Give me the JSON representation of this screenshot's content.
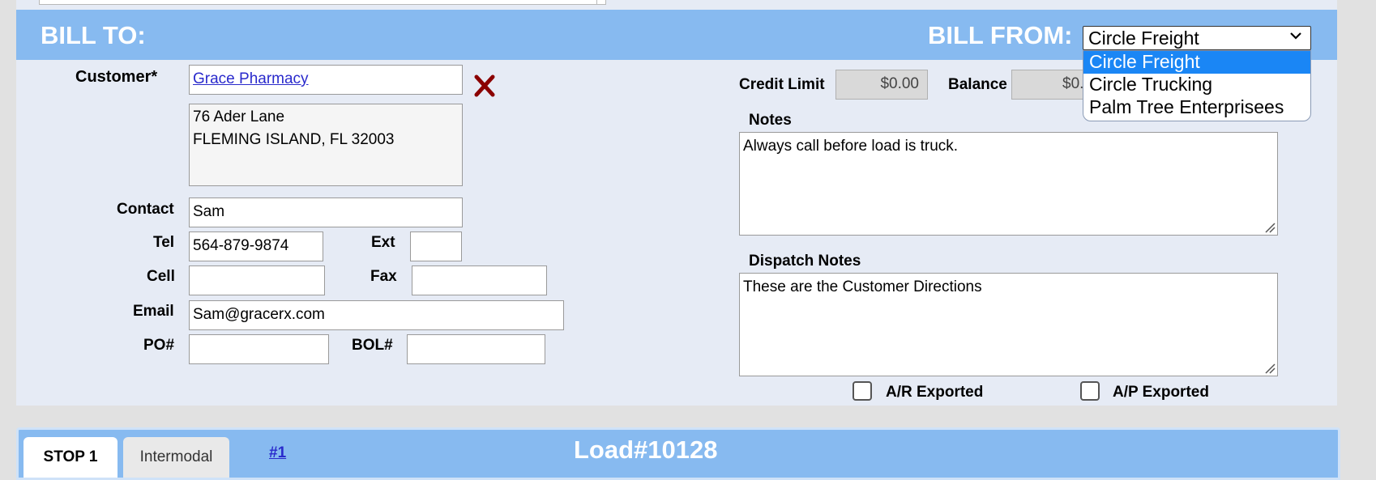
{
  "header": {
    "bill_to_label": "BILL TO:",
    "bill_from_label": "BILL FROM:",
    "bill_from_selected": "Circle Freight",
    "bill_from_options": [
      "Circle Freight",
      "Circle Trucking",
      "Palm Tree Enterprisees"
    ]
  },
  "customer": {
    "label": "Customer*",
    "name": "Grace Pharmacy",
    "address_line1": "76 Ader Lane",
    "address_line2": "FLEMING ISLAND, FL 32003"
  },
  "contact": {
    "contact_label": "Contact",
    "contact_value": "Sam",
    "tel_label": "Tel",
    "tel_value": "564-879-9874",
    "ext_label": "Ext",
    "ext_value": "",
    "cell_label": "Cell",
    "cell_value": "",
    "fax_label": "Fax",
    "fax_value": "",
    "email_label": "Email",
    "email_value": "Sam@gracerx.com",
    "po_label": "PO#",
    "po_value": "",
    "bol_label": "BOL#",
    "bol_value": ""
  },
  "account": {
    "credit_limit_label": "Credit Limit",
    "credit_limit_value": "$0.00",
    "balance_label": "Balance",
    "balance_value": "$0."
  },
  "notes": {
    "notes_label": "Notes",
    "notes_value": "Always call before load is truck.",
    "dispatch_label": "Dispatch Notes",
    "dispatch_value": "These are the Customer Directions"
  },
  "exports": {
    "ar_label": "A/R Exported",
    "ar_checked": false,
    "ap_label": "A/P Exported",
    "ap_checked": false
  },
  "stops": {
    "tab_active": "STOP 1",
    "tab_inactive": "Intermodal",
    "stop_link": "#1",
    "load_title": "Load#10128"
  },
  "colors": {
    "header_blue": "#87baf0",
    "panel_bg": "#e6ebf5",
    "delete_red": "#8b0000",
    "selected_option": "#1a86f5"
  }
}
